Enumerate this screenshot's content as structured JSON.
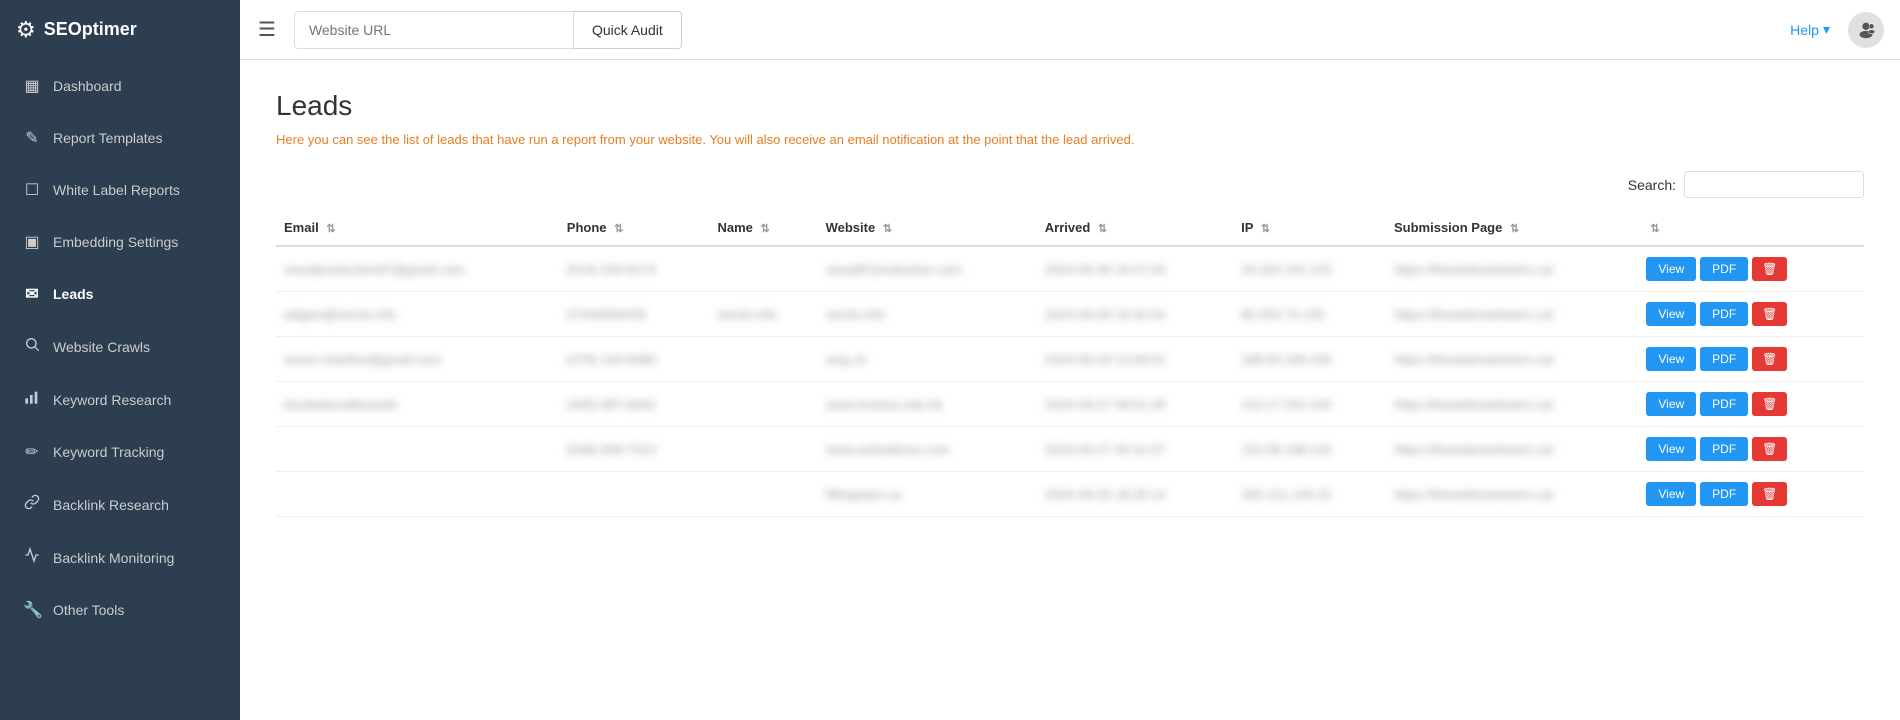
{
  "brand": {
    "name": "SEOptimer",
    "icon": "⚙"
  },
  "topbar": {
    "url_placeholder": "Website URL",
    "audit_button": "Quick Audit",
    "help_label": "Help",
    "help_chevron": "▾"
  },
  "sidebar": {
    "items": [
      {
        "id": "dashboard",
        "label": "Dashboard",
        "icon": "▦"
      },
      {
        "id": "report-templates",
        "label": "Report Templates",
        "icon": "✎"
      },
      {
        "id": "white-label-reports",
        "label": "White Label Reports",
        "icon": "☐"
      },
      {
        "id": "embedding-settings",
        "label": "Embedding Settings",
        "icon": "▣"
      },
      {
        "id": "leads",
        "label": "Leads",
        "icon": "✉",
        "active": true
      },
      {
        "id": "website-crawls",
        "label": "Website Crawls",
        "icon": "🔍"
      },
      {
        "id": "keyword-research",
        "label": "Keyword Research",
        "icon": "📊"
      },
      {
        "id": "keyword-tracking",
        "label": "Keyword Tracking",
        "icon": "✏"
      },
      {
        "id": "backlink-research",
        "label": "Backlink Research",
        "icon": "↗"
      },
      {
        "id": "backlink-monitoring",
        "label": "Backlink Monitoring",
        "icon": "↗"
      },
      {
        "id": "other-tools",
        "label": "Other Tools",
        "icon": "🔧"
      }
    ]
  },
  "page": {
    "title": "Leads",
    "description": "Here you can see the list of leads that have run a report from your website. You will also receive an email notification at the point that the lead arrived.",
    "search_label": "Search:",
    "search_placeholder": ""
  },
  "table": {
    "columns": [
      {
        "id": "email",
        "label": "Email"
      },
      {
        "id": "phone",
        "label": "Phone"
      },
      {
        "id": "name",
        "label": "Name"
      },
      {
        "id": "website",
        "label": "Website"
      },
      {
        "id": "arrived",
        "label": "Arrived"
      },
      {
        "id": "ip",
        "label": "IP"
      },
      {
        "id": "submission_page",
        "label": "Submission Page"
      }
    ],
    "rows": [
      {
        "email": "visualproduction87@gmail.com",
        "phone": "(514) 234-8173",
        "name": "",
        "website": "visual87production.com",
        "arrived": "2024-09-30 16:47:04",
        "ip": "24.202.152.123",
        "submission_page": "https://thewebmarketers.ca/"
      },
      {
        "email": "edgars@serols.info",
        "phone": "07434630435",
        "name": "serols.info",
        "website": "serols.info",
        "arrived": "2024-09-29 16:42:54",
        "ip": "85.254.74.135",
        "submission_page": "https://thewebmarketers.ca/"
      },
      {
        "email": "simon.charlton@gmail.com",
        "phone": "(079) 194-6080",
        "name": "",
        "website": "wng.ch",
        "arrived": "2024-09-29 13:08:02",
        "ip": "188.60.189.200",
        "submission_page": "https://thewebmarketers.ca/"
      },
      {
        "email": "dscdwdsvsdbvswdv",
        "phone": "(345) 687-6942",
        "name": "",
        "website": "www.invictus.edu.hk",
        "arrived": "2024-09-27 08:51:28",
        "ip": "210.17.252.164",
        "submission_page": "https://thewebmarketers.ca/"
      },
      {
        "email": "",
        "phone": "(548) 948-7013",
        "name": "",
        "website": "www.acibuildcon.com",
        "arrived": "2024-09-27 05:41:07",
        "ip": "152.58.198.219",
        "submission_page": "https://thewebmarketers.ca/"
      },
      {
        "email": "",
        "phone": "",
        "name": "",
        "website": "liftingstars.ca",
        "arrived": "2024-09-26 18:29:14",
        "ip": "205.121.140.22",
        "submission_page": "https://thewebmarketers.ca/"
      }
    ],
    "buttons": {
      "view": "View",
      "pdf": "PDF",
      "delete_icon": "🗑"
    }
  }
}
